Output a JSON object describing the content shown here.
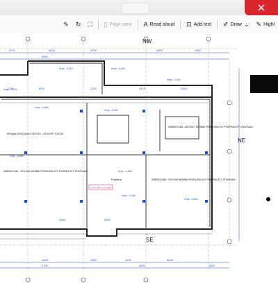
{
  "window": {
    "close_icon": "close-icon"
  },
  "toolbar": {
    "items": [
      {
        "id": "draw-edit",
        "label": "",
        "icon": "pen-icon"
      },
      {
        "id": "rotate",
        "label": "",
        "icon": "rotate-icon"
      },
      {
        "id": "fit-page",
        "label": "",
        "icon": "fit-page-icon"
      },
      {
        "id": "page-view",
        "label": "Page view",
        "icon": "page-view-icon",
        "disabled": true
      },
      {
        "id": "read-aloud",
        "label": "Read aloud",
        "icon": "read-aloud-icon"
      },
      {
        "id": "add-text",
        "label": "Add text",
        "icon": "add-text-icon"
      },
      {
        "id": "draw",
        "label": "Draw",
        "icon": "draw-icon"
      },
      {
        "id": "highlight",
        "label": "Highl",
        "icon": "highlight-icon"
      }
    ]
  },
  "drawing": {
    "orientation": {
      "nw": "NW",
      "ne": "NE",
      "se": "SE"
    },
    "dimensions": [
      "1270",
      "4200",
      "3750",
      "4500",
      "4950",
      "5920",
      "1775",
      "1870",
      "2200",
      "3475",
      "2500",
      "3450",
      "6450",
      "4300",
      "1500",
      "1130",
      "6900",
      "3700",
      "6500",
      "1500"
    ],
    "elevation_labels": [
      "Hmp. -0,610",
      "Hmp. -0,200",
      "Hmp. -0,020",
      "Hmp. -0,010",
      "Hmp. -0,800",
      "Hmp. -0,900",
      "Hmp. -0,300",
      "Hmp. -0,600",
      "Hmp. -0,450",
      "Hmp. -0,500"
    ],
    "notes": [
      "HRANNA VENKOVNICH RETEZU - VSTUVNIT TOSTUE",
      "SMRDES KMA - VSTUVNI DROBNE PROPAJEDLOVY POMPRACETY STAHOVANI",
      "SMRDES KMA - VSTUVNI DROBNE PROPAJEDLOVY POMPRACETY STAHOVANI",
      "SMRDES KMA - ARCHOLT DROBNE PROPAJEDLOVY POMPRACETY STAHOVANI"
    ],
    "callout": "VSTUP DO HALY",
    "room_tag": "Podlaha"
  }
}
